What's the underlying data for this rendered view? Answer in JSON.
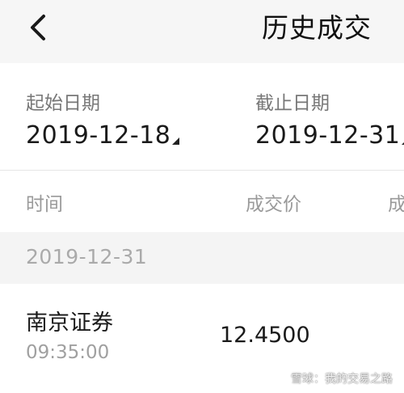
{
  "header": {
    "title": "历史成交"
  },
  "filters": {
    "start_label": "起始日期",
    "start_value": "2019-12-18",
    "end_label": "截止日期",
    "end_value": "2019-12-31"
  },
  "columns": {
    "time": "时间",
    "price": "成交价",
    "next_partial": "成"
  },
  "groups": [
    {
      "date": "2019-12-31",
      "trades": [
        {
          "name": "南京证券",
          "time": "09:35:00",
          "price": "12.4500"
        }
      ]
    }
  ],
  "watermark": {
    "text": "雪球：我的交易之路"
  },
  "colors": {
    "nav_bg": "#f6f6f6",
    "group_bg": "#f4f4f4",
    "label": "#777777",
    "muted": "#9a9a9a"
  },
  "icons": {
    "back": "chevron-left-icon",
    "dropdown": "triangle-corner-icon"
  }
}
